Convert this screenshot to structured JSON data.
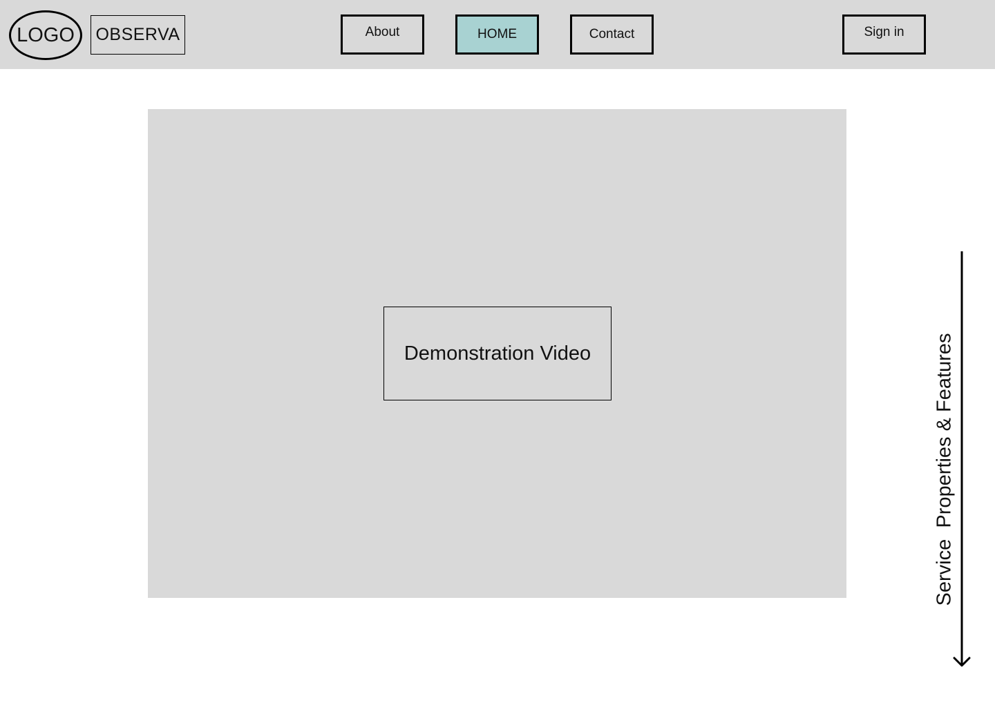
{
  "header": {
    "logo_text": "LOGO",
    "brand_name": "OBSERVA",
    "nav": {
      "about": "About",
      "home": "HOME",
      "contact": "Contact"
    },
    "active_nav": "home",
    "sign_in": "Sign in"
  },
  "main": {
    "video_label": "Demonstration Video"
  },
  "scroll_hint": {
    "label": "Service  Properties & Features",
    "icon": "arrow-down-icon"
  },
  "colors": {
    "header_bg": "#d9d9d9",
    "active_nav_bg": "#a8d2d2",
    "hero_bg": "#d9d9d9"
  }
}
